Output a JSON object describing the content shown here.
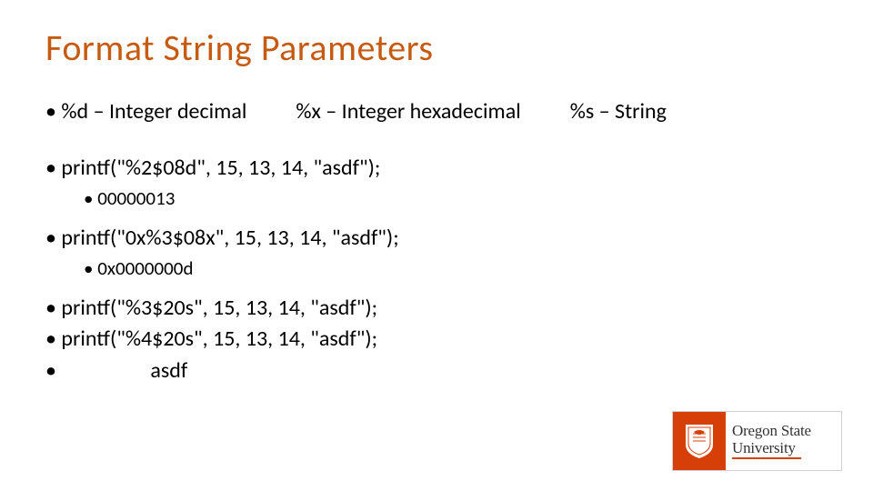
{
  "title": "Format String Parameters",
  "formats": {
    "d": "• %d – Integer decimal",
    "x": "%x – Integer hexadecimal",
    "s": "%s – String"
  },
  "lines": {
    "p1": "• printf(\"%2$08d\", 15, 13, 14, \"asdf\");",
    "o1": "• 00000013",
    "p2": "• printf(\"0x%3$08x\", 15, 13, 14, \"asdf\");",
    "o2": "• 0x0000000d",
    "p3": "• printf(\"%3$20s\", 15, 13, 14, \"asdf\");",
    "p4": "• printf(\"%4$20s\", 15, 13, 14, \"asdf\");",
    "p5_prefix": "•",
    "p5_text": "asdf"
  },
  "logo": {
    "line1": "Oregon State",
    "line2": "University"
  }
}
